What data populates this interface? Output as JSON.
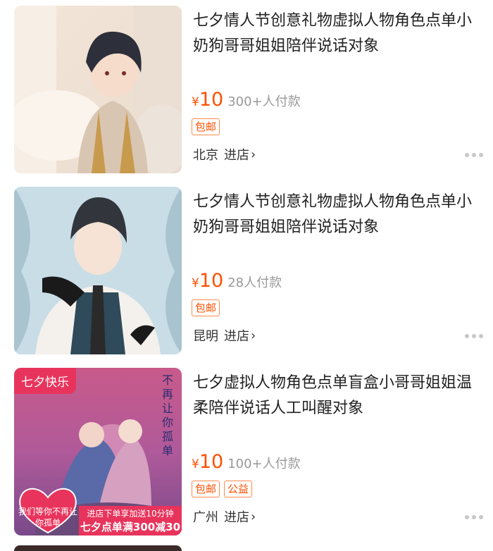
{
  "products": [
    {
      "title": "七夕情人节创意礼物虚拟人物角色点单小奶狗哥哥姐姐陪伴说话对象",
      "price_symbol": "¥",
      "price": "10",
      "sold": "300+人付款",
      "tags": [
        "包邮"
      ],
      "city": "北京",
      "shop_link": "进店",
      "image_icon": "anime-boy-portrait"
    },
    {
      "title": "七夕情人节创意礼物虚拟人物角色点单小奶狗哥哥姐姐陪伴说话对象",
      "price_symbol": "¥",
      "price": "10",
      "sold": "28人付款",
      "tags": [
        "包邮"
      ],
      "city": "昆明",
      "shop_link": "进店",
      "image_icon": "anime-man-gloves-portrait"
    },
    {
      "title": "七夕虚拟人物角色点单盲盒小哥哥姐姐温柔陪伴说话人工叫醒对象",
      "price_symbol": "¥",
      "price": "10",
      "sold": "100+人付款",
      "tags": [
        "包邮",
        "公益"
      ],
      "city": "广州",
      "shop_link": "进店",
      "image_icon": "anime-couple-illustration",
      "image_badge": "七夕快乐",
      "image_heart_text": "我们等你不再让你孤单",
      "image_banner_line1": "进店下单享加送10分钟",
      "image_banner_line2": "七夕点单满300减30",
      "image_vertical_text": "不再让你孤单"
    }
  ],
  "colors": {
    "price": "#ff5000",
    "tag_border": "#ff8a4c",
    "badge": "#e8345c"
  }
}
